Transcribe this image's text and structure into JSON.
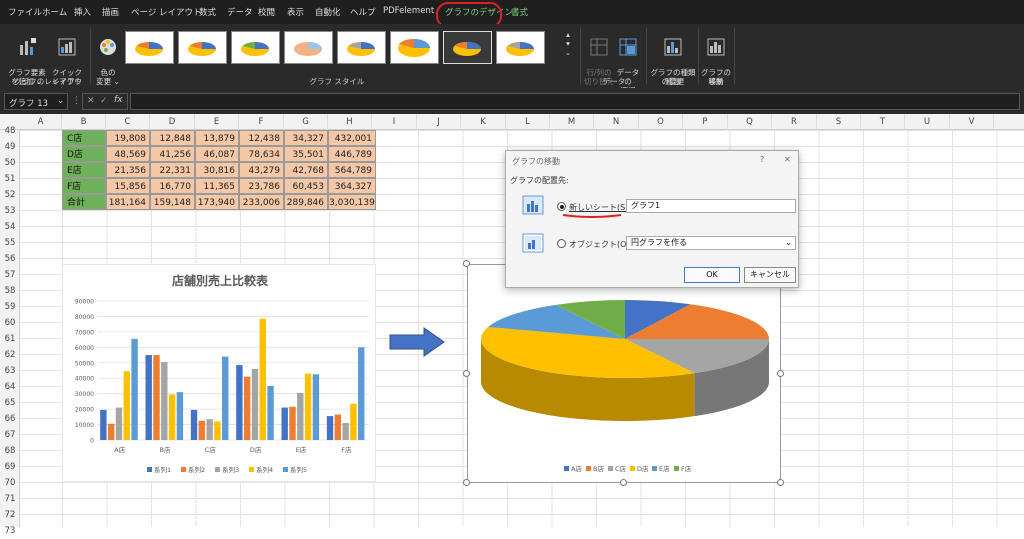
{
  "menu": {
    "items": [
      "ファイル",
      "ホーム",
      "挿入",
      "描画",
      "ページ レイアウト",
      "数式",
      "データ",
      "校閲",
      "表示",
      "自動化",
      "ヘルプ",
      "PDFelement",
      "グラフのデザイン",
      "書式"
    ]
  },
  "ribbon": {
    "add_element": "グラフ要素\nを追加 ⌄",
    "quick_layout": "クイック\nレイアウト ⌄",
    "change_colors": "色の\n変更 ⌄",
    "group_layouts": "グラフのレイアウト",
    "group_styles": "グラフ スタイル",
    "switch_row_col": "行/列の\n切り替え",
    "select_data": "データの\n選択",
    "group_data": "データ",
    "change_type": "グラフの種類\nの変更",
    "group_type": "種類",
    "move_chart": "グラフの\n移動",
    "group_location": "場所"
  },
  "namebox": {
    "value": "グラフ 13"
  },
  "columns": [
    "A",
    "B",
    "C",
    "D",
    "E",
    "F",
    "G",
    "H",
    "I",
    "J",
    "K",
    "L",
    "M",
    "N",
    "O",
    "P",
    "Q",
    "R",
    "S",
    "T",
    "U",
    "V"
  ],
  "rows": [
    "48",
    "49",
    "50",
    "51",
    "52",
    "53",
    "54",
    "55",
    "56",
    "57",
    "58",
    "59",
    "60",
    "61",
    "62",
    "63",
    "64",
    "65",
    "66",
    "67",
    "68",
    "69",
    "70",
    "71",
    "72",
    "73"
  ],
  "table": {
    "rows": [
      {
        "label": "C店",
        "values": [
          "19,808",
          "12,848",
          "13,879",
          "12,438",
          "34,327",
          "432,001"
        ]
      },
      {
        "label": "D店",
        "values": [
          "48,569",
          "41,256",
          "46,087",
          "78,634",
          "35,501",
          "446,789"
        ]
      },
      {
        "label": "E店",
        "values": [
          "21,356",
          "22,331",
          "30,816",
          "43,279",
          "42,768",
          "564,789"
        ]
      },
      {
        "label": "F店",
        "values": [
          "15,856",
          "16,770",
          "11,365",
          "23,786",
          "60,453",
          "364,327"
        ]
      },
      {
        "label": "合計",
        "values": [
          "181,164",
          "159,148",
          "173,940",
          "233,006",
          "289,846",
          "3,030,139"
        ]
      }
    ]
  },
  "chart_data": [
    {
      "type": "bar",
      "title": "店舗別売上比較表",
      "categories": [
        "A店",
        "B店",
        "C店",
        "D店",
        "E店",
        "F店"
      ],
      "ylim": [
        0,
        90000
      ],
      "yticks": [
        "0",
        "10000",
        "20000",
        "30000",
        "40000",
        "50000",
        "60000",
        "70000",
        "80000",
        "90000"
      ],
      "series": [
        {
          "name": "系列1",
          "color": "#4472c4",
          "values": [
            19500,
            55000,
            19500,
            48500,
            21000,
            15500
          ]
        },
        {
          "name": "系列2",
          "color": "#ed7d31",
          "values": [
            10500,
            55000,
            12500,
            41000,
            21500,
            16500
          ]
        },
        {
          "name": "系列3",
          "color": "#a5a5a5",
          "values": [
            21000,
            50500,
            13500,
            46000,
            30500,
            11000
          ]
        },
        {
          "name": "系列4",
          "color": "#ffc000",
          "values": [
            44500,
            29500,
            12000,
            78500,
            43000,
            23500
          ]
        },
        {
          "name": "系列5",
          "color": "#5b9bd5",
          "values": [
            65500,
            31000,
            54000,
            35000,
            42500,
            60000
          ]
        }
      ],
      "legend": "bottom",
      "grid": true
    },
    {
      "type": "pie",
      "categories": [
        "A店",
        "B店",
        "C店",
        "D店",
        "E店",
        "F店"
      ],
      "values": [
        7.5,
        17.5,
        17.0,
        38.0,
        12.0,
        8.0
      ],
      "colors": [
        "#4472c4",
        "#ed7d31",
        "#a5a5a5",
        "#ffc000",
        "#5b9bd5",
        "#70ad47"
      ],
      "legend": "bottom"
    }
  ],
  "dialog": {
    "title": "グラフの移動",
    "help": "?",
    "close": "✕",
    "prompt": "グラフの配置先:",
    "option_new_sheet": "新しいシート(S):",
    "new_sheet_value": "グラフ1",
    "option_object": "オブジェクト(O):",
    "object_value": "円グラフを作る",
    "ok": "OK",
    "cancel": "キャンセル"
  }
}
